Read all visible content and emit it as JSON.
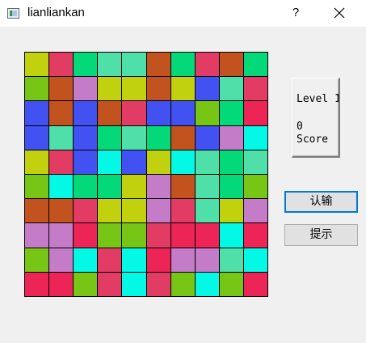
{
  "window": {
    "title": "lianliankan",
    "help_label": "?"
  },
  "board": {
    "rows": [
      [
        "#c1d10e",
        "#e23c65",
        "#04d97a",
        "#4fe0a9",
        "#4fe0a9",
        "#c2531e",
        "#04d97a",
        "#e23c65",
        "#c2531e",
        "#04d97a"
      ],
      [
        "#77c515",
        "#c2531e",
        "#c47bc8",
        "#c1d10e",
        "#c1d10e",
        "#c2531e",
        "#c1d10e",
        "#4151f2",
        "#4fe0a9",
        "#e23c65"
      ],
      [
        "#4151f2",
        "#c2531e",
        "#4151f2",
        "#c2531e",
        "#e23c65",
        "#4151f2",
        "#4151f2",
        "#77c515",
        "#04d97a",
        "#ed2456"
      ],
      [
        "#4151f2",
        "#4fe0a9",
        "#4151f2",
        "#04d97a",
        "#4fe0a9",
        "#04d97a",
        "#c2531e",
        "#4151f2",
        "#c47bc8",
        "#03f8e6"
      ],
      [
        "#c1d10e",
        "#e23c65",
        "#4151f2",
        "#03f8e6",
        "#4151f2",
        "#c1d10e",
        "#03f8e6",
        "#4fe0a9",
        "#04d97a",
        "#4fe0a9"
      ],
      [
        "#77c515",
        "#03f8e6",
        "#04d97a",
        "#04d97a",
        "#c1d10e",
        "#c47bc8",
        "#c2531e",
        "#4fe0a9",
        "#04d97a",
        "#77c515"
      ],
      [
        "#c2531e",
        "#c2531e",
        "#e23c65",
        "#c1d10e",
        "#c1d10e",
        "#c47bc8",
        "#e23c65",
        "#4fe0a9",
        "#c1d10e",
        "#c47bc8"
      ],
      [
        "#c47bc8",
        "#c47bc8",
        "#ed2456",
        "#77c515",
        "#77c515",
        "#e23c65",
        "#ed2456",
        "#ed2456",
        "#03f8e6",
        "#ed2456"
      ],
      [
        "#77c515",
        "#c47bc8",
        "#03f8e6",
        "#e23c65",
        "#03f8e6",
        "#ed2456",
        "#c47bc8",
        "#c47bc8",
        "#4fe0a9",
        "#03f8e6"
      ],
      [
        "#ed2456",
        "#ed2456",
        "#77c515",
        "#e23c65",
        "#03f8e6",
        "#e23c65",
        "#77c515",
        "#03f8e6",
        "#77c515",
        "#ed2456"
      ]
    ]
  },
  "info_panel": {
    "level_label": "Level 1",
    "score_value": "0",
    "score_label": "Score"
  },
  "buttons": {
    "give_up": "认输",
    "hint": "提示"
  }
}
